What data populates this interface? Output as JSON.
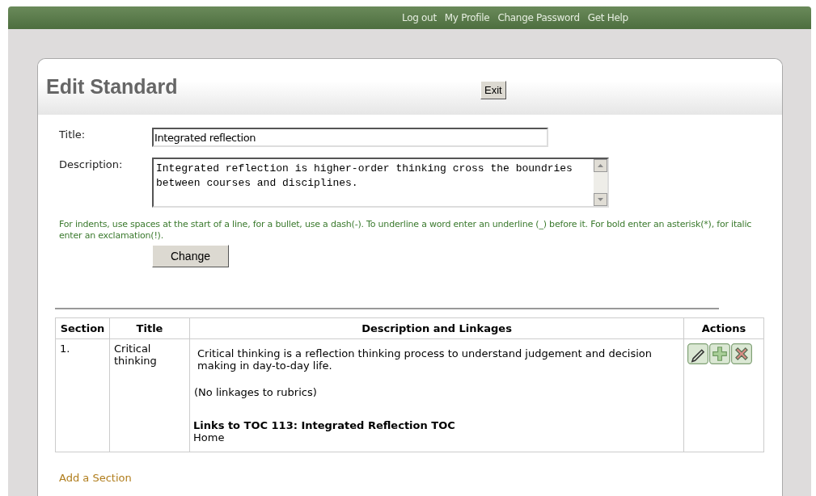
{
  "top_links": [
    "Log out",
    "My Profile",
    "Change Password",
    "Get Help"
  ],
  "page": {
    "title": "Edit Standard",
    "exit_button": "Exit"
  },
  "form": {
    "title_label": "Title:",
    "title_value": "Integrated reflection",
    "description_label": "Description:",
    "description_value": "Integrated reflection is higher-order thinking cross the boundries between courses and disciplines.",
    "hint": "For indents, use spaces at the start of a line, for a bullet, use a dash(-). To underline a word enter an underline (_) before it. For bold enter an asterisk(*), for italic enter an exclamation(!).",
    "change_button": "Change"
  },
  "table": {
    "columns": [
      "Section",
      "Title",
      "Description and Linkages",
      "Actions"
    ],
    "rows": [
      {
        "section": "1.",
        "title": "Critical thinking",
        "description": "Critical thinking is a reflection thinking process to understand judgement and decision making in day-to-day life.",
        "linkages_note": "(No linkages to rubrics)",
        "links_heading": "Links to TOC 113: Integrated Reflection TOC",
        "links_item": "Home",
        "actions": [
          {
            "kind": "edit"
          },
          {
            "kind": "add"
          },
          {
            "kind": "delete"
          }
        ]
      }
    ]
  },
  "add_section_link": "Add a Section"
}
